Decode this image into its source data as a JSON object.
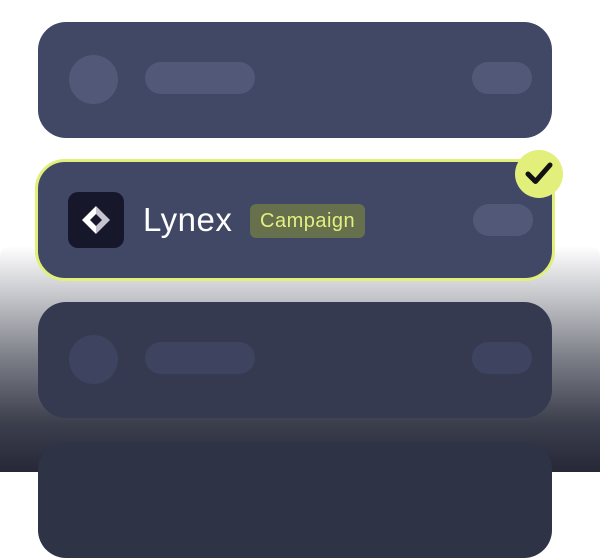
{
  "selected_item": {
    "name": "Lynex",
    "tag": "Campaign",
    "logo_icon": "lynex-logo-icon",
    "selection_icon": "checkmark-icon"
  },
  "colors": {
    "card": "#414866",
    "accent": "#e2ef7a",
    "tag_background": "#67704d",
    "tag_text": "#e3ef80",
    "logo_background": "#17172b"
  }
}
